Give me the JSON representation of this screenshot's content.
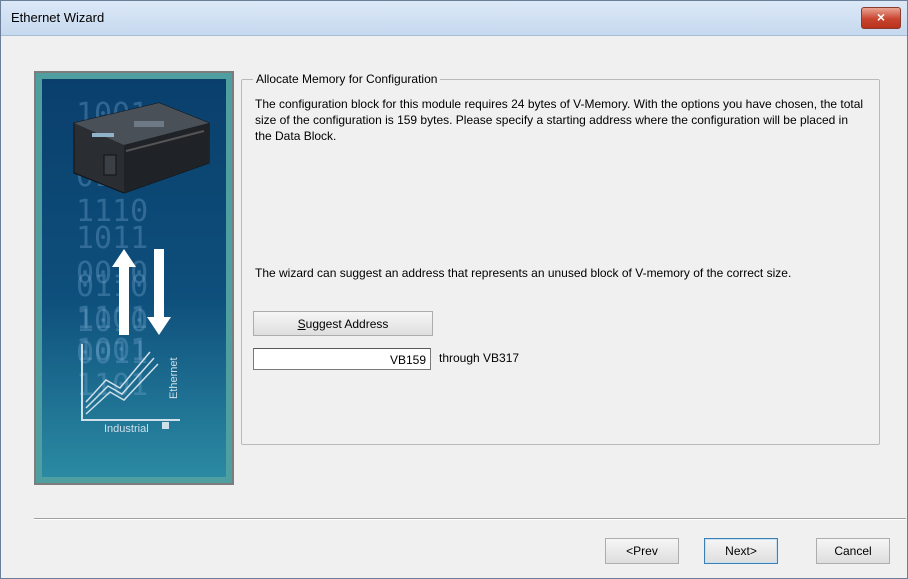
{
  "window": {
    "title": "Ethernet Wizard",
    "close_glyph": "×"
  },
  "sidebar": {
    "binary_rows": [
      "1001 0101",
      "0101 1110",
      "1011 0010",
      "0110 1010",
      "1101 0011",
      "1001 1101"
    ],
    "logo_word_1": "Industrial",
    "logo_word_2": "Ethernet",
    "icons": [
      "plc-module-image",
      "up-down-arrows-icon",
      "industrial-ethernet-logo"
    ]
  },
  "group": {
    "legend": "Allocate Memory for Configuration",
    "description": "The configuration block for this module requires 24 bytes of V-Memory. With the options you have chosen, the total size of the configuration is 159 bytes. Please specify a starting address where the configuration will be placed in the Data Block.",
    "suggest_text": "The wizard can suggest an address that represents an unused block of V-memory of the correct size.",
    "suggest_button_prefix": "S",
    "suggest_button_rest": "uggest Address",
    "address_value": "VB159",
    "through_text": "through VB317"
  },
  "buttons": {
    "prev": "<Prev",
    "next": "Next>",
    "cancel": "Cancel"
  },
  "colors": {
    "titlebar": "#c7d9ef",
    "close": "#c9442e",
    "sidebar": "#0e4f7c",
    "teal": "#4f9fa0"
  }
}
